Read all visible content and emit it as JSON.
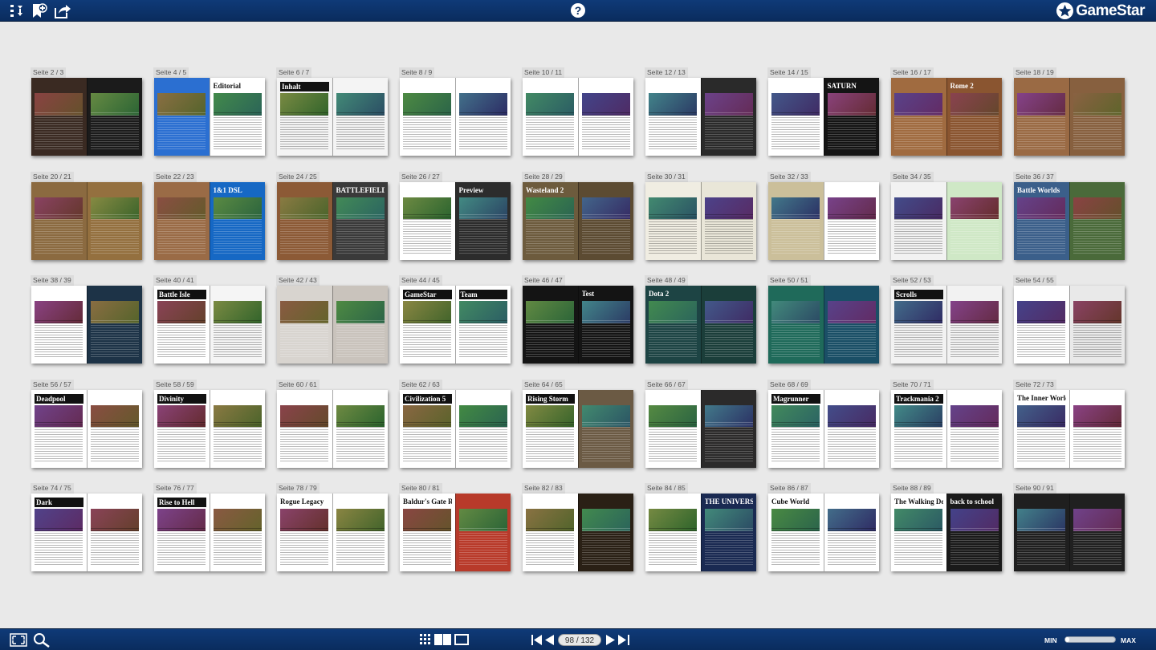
{
  "toolbar": {
    "left_icons": [
      "table-of-contents-icon",
      "bookmark-add-icon",
      "share-icon"
    ],
    "help_label": "?",
    "logo_text": "GameStar"
  },
  "spreads": [
    {
      "label": "Seite 2 / 3",
      "left": {
        "bg": "#3a2a22",
        "title": "",
        "tc": "#fff"
      },
      "right": {
        "bg": "#1b1b1b",
        "title": "",
        "tc": "#fff"
      }
    },
    {
      "label": "Seite 4 / 5",
      "left": {
        "bg": "#2b6fd1",
        "title": "",
        "tc": "#fff"
      },
      "right": {
        "bg": "#ffffff",
        "title": "Editorial",
        "tc": "#111"
      }
    },
    {
      "label": "Seite 6 / 7",
      "left": {
        "bg": "#f4f4f4",
        "title": "Inhalt",
        "tc": "#fff"
      },
      "right": {
        "bg": "#f4f4f4",
        "title": "",
        "tc": "#111"
      }
    },
    {
      "label": "Seite 8 / 9",
      "left": {
        "bg": "#ffffff",
        "title": "",
        "tc": "#111"
      },
      "right": {
        "bg": "#ffffff",
        "title": "",
        "tc": "#111"
      }
    },
    {
      "label": "Seite 10 / 11",
      "left": {
        "bg": "#ffffff",
        "title": "",
        "tc": "#111"
      },
      "right": {
        "bg": "#ffffff",
        "title": "",
        "tc": "#111"
      }
    },
    {
      "label": "Seite 12 / 13",
      "left": {
        "bg": "#ffffff",
        "title": "",
        "tc": "#111"
      },
      "right": {
        "bg": "#2a2a2a",
        "title": "",
        "tc": "#fff"
      }
    },
    {
      "label": "Seite 14 / 15",
      "left": {
        "bg": "#ffffff",
        "title": "",
        "tc": "#111"
      },
      "right": {
        "bg": "#141414",
        "title": "SATURN",
        "tc": "#fff"
      }
    },
    {
      "label": "Seite 16 / 17",
      "left": {
        "bg": "#a06b40",
        "title": "",
        "tc": "#fff"
      },
      "right": {
        "bg": "#8a5530",
        "title": "Rome 2",
        "tc": "#fff"
      }
    },
    {
      "label": "Seite 18 / 19",
      "left": {
        "bg": "#9a6a44",
        "title": "",
        "tc": "#fff"
      },
      "right": {
        "bg": "#87603f",
        "title": "",
        "tc": "#fff"
      }
    },
    {
      "label": "Seite 20 / 21",
      "left": {
        "bg": "#8b6a40",
        "title": "",
        "tc": "#fff"
      },
      "right": {
        "bg": "#94703f",
        "title": "",
        "tc": "#fff"
      }
    },
    {
      "label": "Seite 22 / 23",
      "left": {
        "bg": "#9a6b46",
        "title": "",
        "tc": "#fff"
      },
      "right": {
        "bg": "#1668c4",
        "title": "1&1 DSL",
        "tc": "#fff"
      }
    },
    {
      "label": "Seite 24 / 25",
      "left": {
        "bg": "#8c5a36",
        "title": "",
        "tc": "#fff"
      },
      "right": {
        "bg": "#3a3a3a",
        "title": "BATTLEFIELD",
        "tc": "#fff"
      }
    },
    {
      "label": "Seite 26 / 27",
      "left": {
        "bg": "#ffffff",
        "title": "",
        "tc": "#111"
      },
      "right": {
        "bg": "#2c2c2c",
        "title": "Preview",
        "tc": "#fff"
      }
    },
    {
      "label": "Seite 28 / 29",
      "left": {
        "bg": "#6d5b3d",
        "title": "Wasteland 2",
        "tc": "#fff"
      },
      "right": {
        "bg": "#5c4b32",
        "title": "",
        "tc": "#fff"
      }
    },
    {
      "label": "Seite 30 / 31",
      "left": {
        "bg": "#f0ede2",
        "title": "",
        "tc": "#111"
      },
      "right": {
        "bg": "#e9e6d8",
        "title": "",
        "tc": "#111"
      }
    },
    {
      "label": "Seite 32 / 33",
      "left": {
        "bg": "#cbbf9a",
        "title": "",
        "tc": "#111"
      },
      "right": {
        "bg": "#ffffff",
        "title": "",
        "tc": "#111"
      }
    },
    {
      "label": "Seite 34 / 35",
      "left": {
        "bg": "#f2f2f2",
        "title": "",
        "tc": "#111"
      },
      "right": {
        "bg": "#cfe8c6",
        "title": "",
        "tc": "#111"
      }
    },
    {
      "label": "Seite 36 / 37",
      "left": {
        "bg": "#3b5f8a",
        "title": "Battle Worlds",
        "tc": "#fff"
      },
      "right": {
        "bg": "#4a6a3a",
        "title": "",
        "tc": "#fff"
      }
    },
    {
      "label": "Seite 38 / 39",
      "left": {
        "bg": "#ffffff",
        "title": "",
        "tc": "#111"
      },
      "right": {
        "bg": "#1d3347",
        "title": "",
        "tc": "#fff"
      }
    },
    {
      "label": "Seite 40 / 41",
      "left": {
        "bg": "#ffffff",
        "title": "Battle Isle",
        "tc": "#fff"
      },
      "right": {
        "bg": "#f5f5f5",
        "title": "",
        "tc": "#111"
      }
    },
    {
      "label": "Seite 42 / 43",
      "left": {
        "bg": "#d8d4cf",
        "title": "",
        "tc": "#111"
      },
      "right": {
        "bg": "#c9c3bc",
        "title": "",
        "tc": "#c01010"
      }
    },
    {
      "label": "Seite 44 / 45",
      "left": {
        "bg": "#ffffff",
        "title": "GameStar",
        "tc": "#fff"
      },
      "right": {
        "bg": "#ffffff",
        "title": "Team",
        "tc": "#fff"
      }
    },
    {
      "label": "Seite 46 / 47",
      "left": {
        "bg": "#141414",
        "title": "",
        "tc": "#fff"
      },
      "right": {
        "bg": "#141414",
        "title": "Test",
        "tc": "#fff"
      }
    },
    {
      "label": "Seite 48 / 49",
      "left": {
        "bg": "#1d4444",
        "title": "Dota 2",
        "tc": "#fff"
      },
      "right": {
        "bg": "#1b3e3a",
        "title": "",
        "tc": "#fff"
      }
    },
    {
      "label": "Seite 50 / 51",
      "left": {
        "bg": "#1f6a5a",
        "title": "",
        "tc": "#fff"
      },
      "right": {
        "bg": "#1a4f66",
        "title": "",
        "tc": "#fff"
      }
    },
    {
      "label": "Seite 52 / 53",
      "left": {
        "bg": "#f2f2f2",
        "title": "Scrolls",
        "tc": "#fff"
      },
      "right": {
        "bg": "#f2f2f2",
        "title": "",
        "tc": "#111"
      }
    },
    {
      "label": "Seite 54 / 55",
      "left": {
        "bg": "#ffffff",
        "title": "",
        "tc": "#111"
      },
      "right": {
        "bg": "#e9e9e9",
        "title": "",
        "tc": "#111"
      }
    },
    {
      "label": "Seite 56 / 57",
      "left": {
        "bg": "#ffffff",
        "title": "Deadpool",
        "tc": "#fff"
      },
      "right": {
        "bg": "#ffffff",
        "title": "",
        "tc": "#111"
      }
    },
    {
      "label": "Seite 58 / 59",
      "left": {
        "bg": "#ffffff",
        "title": "Divinity",
        "tc": "#fff"
      },
      "right": {
        "bg": "#ffffff",
        "title": "",
        "tc": "#111"
      }
    },
    {
      "label": "Seite 60 / 61",
      "left": {
        "bg": "#ffffff",
        "title": "",
        "tc": "#111"
      },
      "right": {
        "bg": "#ffffff",
        "title": "",
        "tc": "#111"
      }
    },
    {
      "label": "Seite 62 / 63",
      "left": {
        "bg": "#ffffff",
        "title": "Civilization 5",
        "tc": "#fff"
      },
      "right": {
        "bg": "#ffffff",
        "title": "",
        "tc": "#111"
      }
    },
    {
      "label": "Seite 64 / 65",
      "left": {
        "bg": "#ffffff",
        "title": "Rising Storm",
        "tc": "#fff"
      },
      "right": {
        "bg": "#6b5a44",
        "title": "",
        "tc": "#fff"
      }
    },
    {
      "label": "Seite 66 / 67",
      "left": {
        "bg": "#ffffff",
        "title": "",
        "tc": "#111"
      },
      "right": {
        "bg": "#2b2a2a",
        "title": "",
        "tc": "#fff"
      }
    },
    {
      "label": "Seite 68 / 69",
      "left": {
        "bg": "#ffffff",
        "title": "Magrunner",
        "tc": "#fff"
      },
      "right": {
        "bg": "#ffffff",
        "title": "",
        "tc": "#111"
      }
    },
    {
      "label": "Seite 70 / 71",
      "left": {
        "bg": "#ffffff",
        "title": "Trackmania 2",
        "tc": "#fff"
      },
      "right": {
        "bg": "#ffffff",
        "title": "",
        "tc": "#111"
      }
    },
    {
      "label": "Seite 72 / 73",
      "left": {
        "bg": "#ffffff",
        "title": "The Inner World",
        "tc": "#111"
      },
      "right": {
        "bg": "#ffffff",
        "title": "",
        "tc": "#111"
      }
    },
    {
      "label": "Seite 74 / 75",
      "left": {
        "bg": "#ffffff",
        "title": "Dark",
        "tc": "#fff"
      },
      "right": {
        "bg": "#ffffff",
        "title": "",
        "tc": "#111"
      }
    },
    {
      "label": "Seite 76 / 77",
      "left": {
        "bg": "#ffffff",
        "title": "Rise to Hell",
        "tc": "#fff"
      },
      "right": {
        "bg": "#ffffff",
        "title": "",
        "tc": "#111"
      }
    },
    {
      "label": "Seite 78 / 79",
      "left": {
        "bg": "#ffffff",
        "title": "Rogue Legacy",
        "tc": "#111"
      },
      "right": {
        "bg": "#ffffff",
        "title": "",
        "tc": "#111"
      }
    },
    {
      "label": "Seite 80 / 81",
      "left": {
        "bg": "#ffffff",
        "title": "Baldur's Gate Reloaded",
        "tc": "#111"
      },
      "right": {
        "bg": "#b83a2a",
        "title": "",
        "tc": "#fff"
      }
    },
    {
      "label": "Seite 82 / 83",
      "left": {
        "bg": "#ffffff",
        "title": "",
        "tc": "#111"
      },
      "right": {
        "bg": "#2a2015",
        "title": "",
        "tc": "#fff"
      }
    },
    {
      "label": "Seite 84 / 85",
      "left": {
        "bg": "#ffffff",
        "title": "",
        "tc": "#111"
      },
      "right": {
        "bg": "#1a2a52",
        "title": "THE UNIVERSE OF FANDOM",
        "tc": "#fff"
      }
    },
    {
      "label": "Seite 86 / 87",
      "left": {
        "bg": "#ffffff",
        "title": "Cube World",
        "tc": "#111"
      },
      "right": {
        "bg": "#ffffff",
        "title": "",
        "tc": "#111"
      }
    },
    {
      "label": "Seite 88 / 89",
      "left": {
        "bg": "#ffffff",
        "title": "The Walking Dead",
        "tc": "#111"
      },
      "right": {
        "bg": "#1a1a1a",
        "title": "back to school",
        "tc": "#fff"
      }
    },
    {
      "label": "Seite 90 / 91",
      "left": {
        "bg": "#1f1f1f",
        "title": "",
        "tc": "#fff"
      },
      "right": {
        "bg": "#202020",
        "title": "",
        "tc": "#fff"
      }
    }
  ],
  "footer": {
    "page_indicator": "98 / 132",
    "zoom_min": "MIN",
    "zoom_max": "MAX",
    "zoom_level": 0.08
  }
}
